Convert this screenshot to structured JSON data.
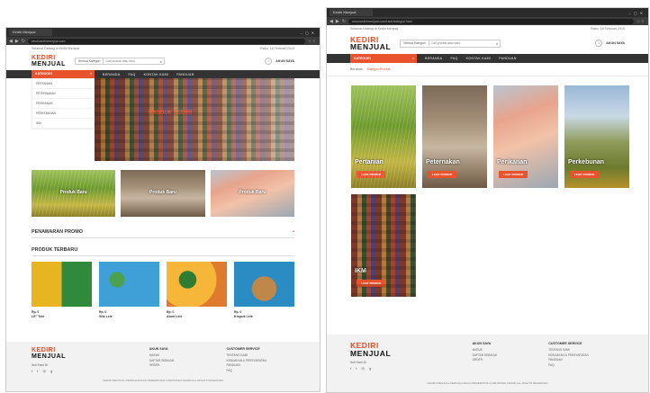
{
  "left": {
    "tab_title": "Kediri Menjual",
    "url": "www.kedirimenjual.com",
    "topline_left": "Selamat Datang di Kediri Menjual",
    "topline_right": "Rabu, 18 Februari 2015",
    "logo_line1": "KEDIRI",
    "logo_line2": "MENJUAL",
    "search_category": "Semua Kategori",
    "search_placeholder": "Cari produk atau toko",
    "account_label": "AKUN SAYA",
    "category_button": "KATEGORI",
    "nav": [
      "BERANDA",
      "FAQ",
      "KONTAK KAMI",
      "PANDUAN"
    ],
    "category_menu": [
      "PERTANIAN",
      "PETERNAKAN",
      "PERIKANAN",
      "PERKEBUNAN",
      "IKM"
    ],
    "hero_text": "PRODUK KEDIRI",
    "banners": [
      "Produk Baru",
      "Produk Baru",
      "Produk Baru"
    ],
    "promo_title": "PENAWARAN PROMO",
    "new_title": "PRODUK TERBARU",
    "products": [
      {
        "price": "Rp. 0",
        "name": "LE\" Tole"
      },
      {
        "price": "Rp. 0",
        "name": "Stik Lele"
      },
      {
        "price": "Rp. 0",
        "name": "Abon Lele"
      },
      {
        "price": "Rp. 0",
        "name": "Krupuk Lele"
      }
    ],
    "footer_follow": "Ikuti Kami Di",
    "footer_col1_title": "AKUN SAYA",
    "footer_col1_links": [
      "MASUK",
      "DAFTAR SEBAGAI",
      "ORDER"
    ],
    "footer_col2_title": "CUSTOMER SERVICE",
    "footer_col2_links": [
      "TENTANG KAMI",
      "KEBIJAKAN & PERSYARATAN",
      "PANDUAN",
      "FAQ"
    ],
    "copyright": "KEDIRI MENJUAL PERDAGANGAN PEMERINTAH KABUPATEN KEDIRI ALL RIGHTS RESERVED"
  },
  "right": {
    "tab_title": "Kediri Menjual",
    "url": "www.kedirimenjual.com/user/kategori.html",
    "topline_left": "Selamat Datang di Kediri Menjual",
    "topline_right": "Rabu, 18 Februari 2015",
    "logo_line1": "KEDIRI",
    "logo_line2": "MENJUAL",
    "search_category": "Semua Kategori",
    "search_placeholder": "Cari produk atau toko",
    "account_label": "AKUN SAYA",
    "category_button": "KATEGORI",
    "nav": [
      "BERANDA",
      "FAQ",
      "KONTAK KAMI",
      "PANDUAN"
    ],
    "breadcrumb_home": "Beranda",
    "breadcrumb_current": "Kategori Produk",
    "categories": [
      {
        "label": "Pertanian",
        "button": "LIHAT PRODUK"
      },
      {
        "label": "Peternakan",
        "button": "LIHAT PRODUK"
      },
      {
        "label": "Perikanan",
        "button": "LIHAT PRODUK"
      },
      {
        "label": "Perkebunan",
        "button": "LIHAT PRODUK"
      },
      {
        "label": "IKM",
        "button": "LIHAT PRODUK"
      }
    ],
    "footer_follow": "Ikuti Kami Di",
    "footer_col1_title": "AKUN SAYA",
    "footer_col1_links": [
      "MASUK",
      "DAFTAR SEBAGAI",
      "ORDER"
    ],
    "footer_col2_title": "CUSTOMER SERVICE",
    "footer_col2_links": [
      "TENTANG KAMI",
      "KEBIJAKAN & PERSYARATAN",
      "PANDUAN",
      "FAQ"
    ],
    "copyright": "KEDIRI MENJUAL PERDAGANGAN PEMERINTAH KABUPATEN KEDIRI ALL RIGHTS RESERVED"
  },
  "colors": {
    "accent": "#e8532e",
    "navbar": "#333333",
    "logo_green": "#2f8a3b"
  },
  "icons": [
    "search-icon",
    "user-icon",
    "menu-icon",
    "facebook-icon",
    "twitter-icon",
    "instagram-icon",
    "googleplus-icon"
  ]
}
